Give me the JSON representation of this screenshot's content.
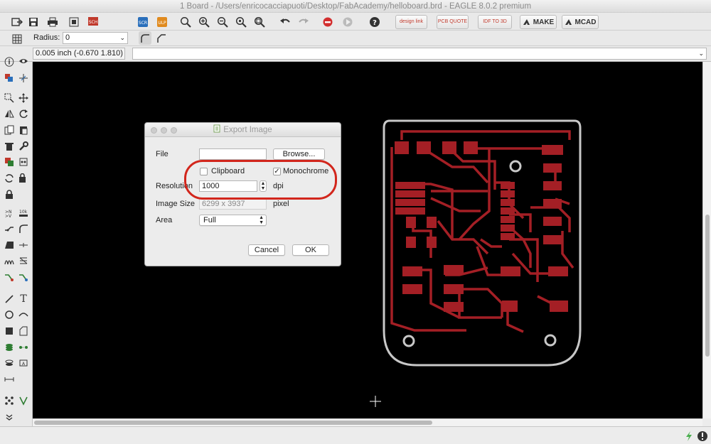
{
  "window": {
    "title": "1 Board - /Users/enricocacciapuoti/Desktop/FabAcademy/helloboard.brd - EAGLE 8.0.2 premium"
  },
  "toolbar": {
    "design_link_label": "design link",
    "pcb_quote_label": "PCB QUOTE",
    "idf_label": "IDF TO 3D",
    "make_label": "MAKE",
    "mcad_label": "MCAD",
    "scr_label": "SCR",
    "ulp_label": "ULP"
  },
  "params": {
    "radius_label": "Radius:",
    "radius_value": "0"
  },
  "command": {
    "coordinates": "0.005 inch (-0.670 1.810)",
    "input_value": ""
  },
  "dialog": {
    "title": "Export Image",
    "file_label": "File",
    "file_value": "",
    "browse_label": "Browse...",
    "clipboard_label": "Clipboard",
    "clipboard_checked": false,
    "monochrome_label": "Monochrome",
    "monochrome_checked": true,
    "check_mark": "✓",
    "resolution_label": "Resolution",
    "resolution_value": "1000",
    "resolution_unit": "dpi",
    "image_size_label": "Image Size",
    "image_size_value": "6299 x 3937",
    "image_size_unit": "pixel",
    "area_label": "Area",
    "area_value": "Full",
    "cancel_label": "Cancel",
    "ok_label": "OK"
  },
  "colors": {
    "trace": "#a41f25",
    "outline": "#c8c8c8",
    "highlight": "#d2261c",
    "canvas": "#000000"
  }
}
